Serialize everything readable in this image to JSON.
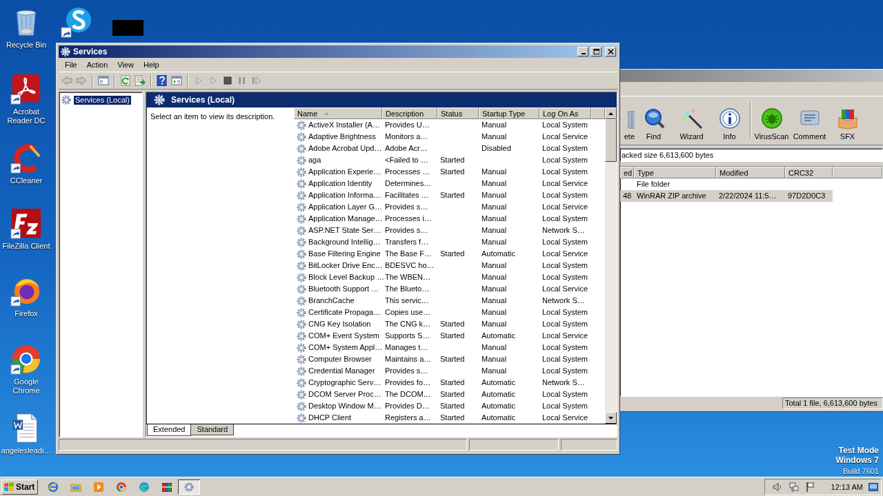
{
  "desktop": {
    "icons": [
      {
        "label": "Recycle Bin",
        "kind": "recycle-bin"
      },
      {
        "label": "Acrobat Reader DC",
        "kind": "pdf-reader"
      },
      {
        "label": "CCleaner",
        "kind": "cleaner"
      },
      {
        "label": "FileZilla Client",
        "kind": "ftp-client"
      },
      {
        "label": "Firefox",
        "kind": "firefox"
      },
      {
        "label": "Google Chrome",
        "kind": "chrome"
      },
      {
        "label": "angelesleadi…",
        "kind": "document"
      }
    ],
    "system_text": [
      "Test Mode",
      "Windows 7",
      "Build 7601"
    ]
  },
  "winrar": {
    "toolbar": [
      {
        "label": "ete",
        "kind": "delete"
      },
      {
        "label": "Find",
        "kind": "find"
      },
      {
        "label": "Wizard",
        "kind": "wizard"
      },
      {
        "label": "Info",
        "kind": "info"
      },
      {
        "label": "VirusScan",
        "kind": "virusscan"
      },
      {
        "label": "Comment",
        "kind": "comment"
      },
      {
        "label": "SFX",
        "kind": "sfx"
      }
    ],
    "address": "acked size 6,613,600 bytes",
    "columns": [
      "ed",
      "Type",
      "Modified",
      "CRC32"
    ],
    "rows": [
      {
        "type": "File folder",
        "selected": false
      },
      {
        "column_1": "48",
        "type": "WinRAR ZIP archive",
        "modified": "2/22/2024 11:5…",
        "crc32": "97D2D0C3",
        "selected": true
      }
    ],
    "status_bar": "Total 1 file, 6,613,600 bytes"
  },
  "services": {
    "window": {
      "title": "Services"
    },
    "menu": [
      "File",
      "Action",
      "View",
      "Help"
    ],
    "tree": [
      {
        "label": "Services (Local)",
        "selected": true
      }
    ],
    "pane_title": "Services (Local)",
    "description": "Select an item to view its description.",
    "columns": [
      {
        "label": "Name",
        "sorted": true
      },
      {
        "label": "Description"
      },
      {
        "label": "Status"
      },
      {
        "label": "Startup Type"
      },
      {
        "label": "Log On As"
      }
    ],
    "rows": [
      {
        "name": "ActiveX Installer (A…",
        "description": "Provides U…",
        "startup_type": "Manual",
        "log_on_as": "Local System"
      },
      {
        "name": "Adaptive Brightness",
        "description": "Monitors a…",
        "startup_type": "Manual",
        "log_on_as": "Local Service"
      },
      {
        "name": "Adobe Acrobat Upd…",
        "description": "Adobe Acr…",
        "startup_type": "Disabled",
        "log_on_as": "Local System"
      },
      {
        "name": "aga",
        "description": "<Failed to …",
        "status": "Started",
        "log_on_as": "Local System"
      },
      {
        "name": "Application Experie…",
        "description": "Processes …",
        "status": "Started",
        "startup_type": "Manual",
        "log_on_as": "Local System"
      },
      {
        "name": "Application Identity",
        "description": "Determines…",
        "startup_type": "Manual",
        "log_on_as": "Local Service"
      },
      {
        "name": "Application Informa…",
        "description": "Facilitates …",
        "status": "Started",
        "startup_type": "Manual",
        "log_on_as": "Local System"
      },
      {
        "name": "Application Layer G…",
        "description": "Provides s…",
        "startup_type": "Manual",
        "log_on_as": "Local Service"
      },
      {
        "name": "Application Manage…",
        "description": "Processes i…",
        "startup_type": "Manual",
        "log_on_as": "Local System"
      },
      {
        "name": "ASP.NET State Ser…",
        "description": "Provides s…",
        "startup_type": "Manual",
        "log_on_as": "Network S…"
      },
      {
        "name": "Background Intellig…",
        "description": "Transfers f…",
        "startup_type": "Manual",
        "log_on_as": "Local System"
      },
      {
        "name": "Base Filtering Engine",
        "description": "The Base F…",
        "status": "Started",
        "startup_type": "Automatic",
        "log_on_as": "Local Service"
      },
      {
        "name": "BitLocker Drive Enc…",
        "description": "BDESVC ho…",
        "startup_type": "Manual",
        "log_on_as": "Local System"
      },
      {
        "name": "Block Level Backup …",
        "description": "The WBEN…",
        "startup_type": "Manual",
        "log_on_as": "Local System"
      },
      {
        "name": "Bluetooth Support …",
        "description": "The Blueto…",
        "startup_type": "Manual",
        "log_on_as": "Local Service"
      },
      {
        "name": "BranchCache",
        "description": "This servic…",
        "startup_type": "Manual",
        "log_on_as": "Network S…"
      },
      {
        "name": "Certificate Propaga…",
        "description": "Copies use…",
        "startup_type": "Manual",
        "log_on_as": "Local System"
      },
      {
        "name": "CNG Key Isolation",
        "description": "The CNG k…",
        "status": "Started",
        "startup_type": "Manual",
        "log_on_as": "Local System"
      },
      {
        "name": "COM+ Event System",
        "description": "Supports S…",
        "status": "Started",
        "startup_type": "Automatic",
        "log_on_as": "Local Service"
      },
      {
        "name": "COM+ System Appl…",
        "description": "Manages t…",
        "startup_type": "Manual",
        "log_on_as": "Local System"
      },
      {
        "name": "Computer Browser",
        "description": "Maintains a…",
        "status": "Started",
        "startup_type": "Manual",
        "log_on_as": "Local System"
      },
      {
        "name": "Credential Manager",
        "description": "Provides s…",
        "startup_type": "Manual",
        "log_on_as": "Local System"
      },
      {
        "name": "Cryptographic Serv…",
        "description": "Provides fo…",
        "status": "Started",
        "startup_type": "Automatic",
        "log_on_as": "Network S…"
      },
      {
        "name": "DCOM Server Proc…",
        "description": "The DCOM…",
        "status": "Started",
        "startup_type": "Automatic",
        "log_on_as": "Local System"
      },
      {
        "name": "Desktop Window M…",
        "description": "Provides D…",
        "status": "Started",
        "startup_type": "Automatic",
        "log_on_as": "Local System"
      },
      {
        "name": "DHCP Client",
        "description": "Registers a…",
        "status": "Started",
        "startup_type": "Automatic",
        "log_on_as": "Local Service"
      }
    ],
    "tabs": [
      {
        "label": "Extended",
        "selected": true
      },
      {
        "label": "Standard",
        "selected": false
      }
    ]
  },
  "taskbar": {
    "start": "Start",
    "clock": "12:13 AM"
  }
}
